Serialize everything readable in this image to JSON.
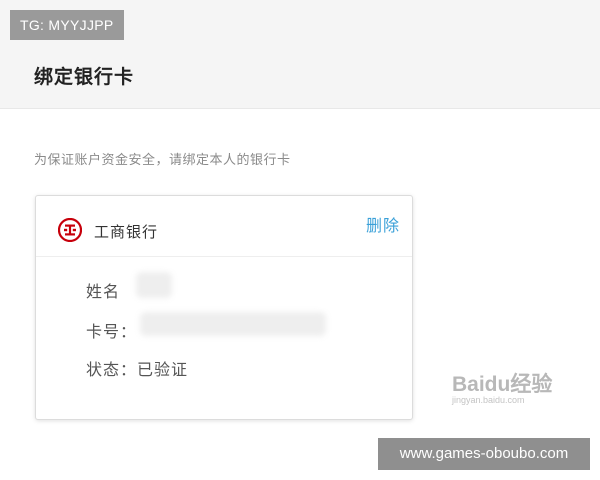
{
  "watermark_tg": "TG: MYYJJPP",
  "page": {
    "title": "绑定银行卡",
    "notice": "为保证账户资金安全，请绑定本人的银行卡"
  },
  "card": {
    "bank_name": "工商银行",
    "bank_logo_icon": "icbc-logo-icon",
    "brand_color": "#c7000b",
    "delete_label": "删除",
    "link_color": "#3aa0d8",
    "name_label": "姓名",
    "card_no_label": "卡号：",
    "status_label": "状态：",
    "status_value": "已验证"
  },
  "watermark_baidu": {
    "text": "Baidu经验",
    "sub": "jingyan.baidu.com"
  },
  "watermark_site": "www.games-oboubo.com"
}
